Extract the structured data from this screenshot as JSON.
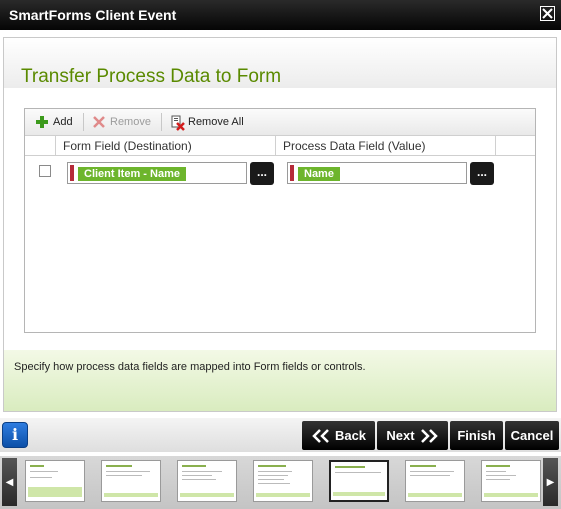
{
  "window": {
    "title": "SmartForms Client Event",
    "close_icon": "close-icon"
  },
  "page": {
    "title": "Transfer Process Data to Form"
  },
  "toolbar": {
    "add_label": "Add",
    "remove_label": "Remove",
    "remove_all_label": "Remove All"
  },
  "columns": {
    "form_field": "Form Field (Destination)",
    "process_field": "Process Data Field (Value)"
  },
  "mapping_rows": [
    {
      "form_field": "Client Item - Name",
      "process_field": "Name",
      "ellipsis": "..."
    }
  ],
  "info_text": "Specify how process data fields are mapped into Form fields or controls.",
  "footer": {
    "back_label": "Back",
    "next_label": "Next",
    "finish_label": "Finish",
    "cancel_label": "Cancel"
  },
  "colors": {
    "title_green": "#5a8a00",
    "token_green": "#6db52c",
    "required_red": "#b52b3a"
  }
}
